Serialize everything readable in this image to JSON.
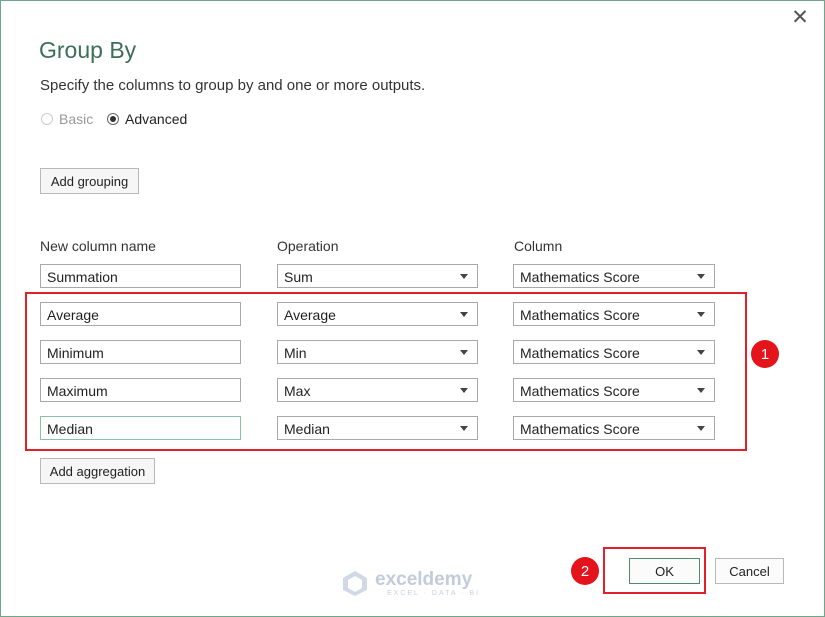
{
  "dialog": {
    "title": "Group By",
    "subtitle": "Specify the columns to group by and one or more outputs.",
    "close_icon": "close-icon"
  },
  "mode": {
    "basic_label": "Basic",
    "advanced_label": "Advanced",
    "selected": "Advanced"
  },
  "buttons": {
    "add_grouping": "Add grouping",
    "add_aggregation": "Add aggregation",
    "ok": "OK",
    "cancel": "Cancel"
  },
  "columns": {
    "name": "New column name",
    "operation": "Operation",
    "column": "Column"
  },
  "aggregations": [
    {
      "name": "Summation",
      "operation": "Sum",
      "column": "Mathematics Score"
    },
    {
      "name": "Average",
      "operation": "Average",
      "column": "Mathematics Score"
    },
    {
      "name": "Minimum",
      "operation": "Min",
      "column": "Mathematics Score"
    },
    {
      "name": "Maximum",
      "operation": "Max",
      "column": "Mathematics Score"
    },
    {
      "name": "Median",
      "operation": "Median",
      "column": "Mathematics Score"
    }
  ],
  "annotations": {
    "badge_1": "1",
    "badge_2": "2"
  },
  "watermark": {
    "name": "exceldemy",
    "tagline": "EXCEL · DATA · BI"
  },
  "colors": {
    "accent": "#3c6e58",
    "highlight": "#e0202a"
  }
}
